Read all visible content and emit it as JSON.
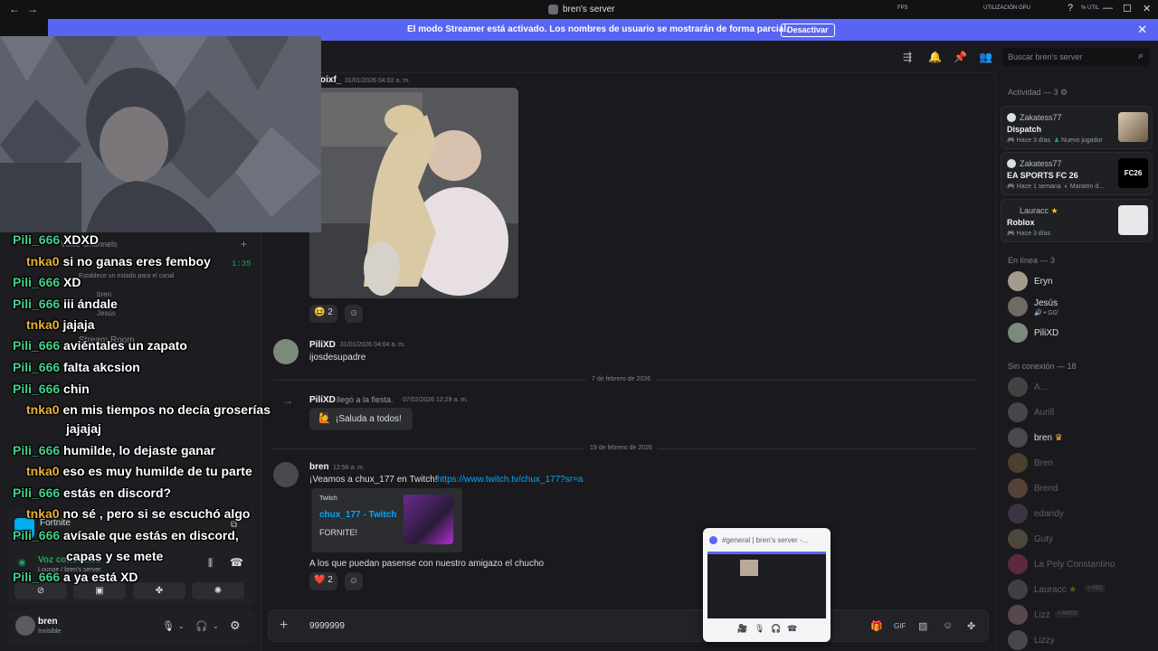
{
  "titlebar": {
    "back": "←",
    "forward": "→",
    "title": "bren's server",
    "fps": "FPS",
    "gpu": "UTILIZACIÓN GPU",
    "util": "% UTIL",
    "help": "?",
    "minimize": "—",
    "maximize": "☐",
    "close": "✕"
  },
  "banner": {
    "message": "El modo Streamer está activado. Los nombres de usuario se mostrarán de forma parcial.",
    "button": "Desactivar",
    "close": "✕"
  },
  "search": {
    "placeholder": "Buscar bren's server"
  },
  "sidebar": {
    "voice_channels": "Voice Channels",
    "timer": "1:35",
    "status_hint": "Establece un estado para el canal",
    "voice_users": [
      "bren",
      "Jesús"
    ],
    "stream_room": "Stream Room",
    "game": "Fortnite",
    "voice_connected": "Voz conectada",
    "voice_location": "Lounge / bren's server",
    "user_name": "bren",
    "user_status": "Invisible"
  },
  "messages": [
    {
      "author": "oixf_",
      "time": "31/01/2026 04:02 a. m.",
      "reactions": [
        {
          "emoji": "😆",
          "count": "2"
        }
      ]
    },
    {
      "author": "PiliXD",
      "time": "31/01/2026 04:04 a. m.",
      "text": "ijosdesupadre"
    },
    {
      "divider": "7 de febrero de 2026"
    },
    {
      "author": "PiliXD",
      "join_text": "llegó a la fiesta.",
      "time": "07/02/2026 12:29 a. m.",
      "button": "¡Saluda a todos!"
    },
    {
      "divider": "19 de febrero de 2026"
    },
    {
      "author": "bren",
      "time": "12:56 a. m.",
      "text": "¡Veamos a chux_177 en Twitch!",
      "link": "https://www.twitch.tv/chux_177?sr=a",
      "embed": {
        "provider": "Twitch",
        "title": "chux_177 - Twitch",
        "desc": "FORNITE!"
      },
      "text2": "A los que puedan pasense con nuestro amigazo el chucho",
      "reactions": [
        {
          "emoji": "❤️",
          "count": "2"
        }
      ]
    }
  ],
  "composer": {
    "value": "9999999"
  },
  "members": {
    "activity_header": "Actividad — 3",
    "activities": [
      {
        "user": "Zakatess77",
        "game": "Dispatch",
        "meta": "Hace 3 días",
        "meta2": "Nuevo jugador"
      },
      {
        "user": "Zakatess77",
        "game": "EA SPORTS FC 26",
        "meta": "Hace 1 semana",
        "meta2": "Maratón d...",
        "thumb": "FC26"
      },
      {
        "user": "Lauracc",
        "game": "Roblox",
        "meta": "Hace 3 días"
      }
    ],
    "online_header": "En línea — 3",
    "online": [
      {
        "name": "Eryn"
      },
      {
        "name": "Jesús",
        "sub": "• GG'"
      },
      {
        "name": "PiliXD"
      }
    ],
    "offline_header": "Sin conexión — 18",
    "offline": [
      "A...",
      "Aurill",
      "bren",
      "Bren",
      "Brend",
      "edandy",
      "Guty",
      "La Pely Constantino",
      "Lauracc",
      "Lizz",
      "Lizzy"
    ],
    "badges": {
      "lauracc": "FEC",
      "lizz": "HATO"
    }
  },
  "stream_chat": [
    {
      "user": "Pili_666",
      "color": "n1",
      "text": "XDXD"
    },
    {
      "user": "tnka0",
      "color": "n2",
      "text": "si no ganas eres femboy"
    },
    {
      "user": "Pili_666",
      "color": "n1",
      "text": "XD"
    },
    {
      "user": "Pili_666",
      "color": "n1",
      "text": "iii ándale"
    },
    {
      "user": "tnka0",
      "color": "n2",
      "text": "jajaja"
    },
    {
      "user": "Pili_666",
      "color": "n1",
      "text": "aviéntales un zapato"
    },
    {
      "user": "Pili_666",
      "color": "n1",
      "text": "falta akcsion"
    },
    {
      "user": "Pili_666",
      "color": "n1",
      "text": "chin"
    },
    {
      "user": "tnka0",
      "color": "n2",
      "text": "en mis tiempos no decía groserías"
    },
    {
      "user": "",
      "color": "n2",
      "text": "jajajaj"
    },
    {
      "user": "Pili_666",
      "color": "n1",
      "text": "humilde, lo dejaste ganar"
    },
    {
      "user": "tnka0",
      "color": "n2",
      "text": "eso es muy humilde de tu parte"
    },
    {
      "user": "Pili_666",
      "color": "n1",
      "text": "estás en discord?"
    },
    {
      "user": "tnka0",
      "color": "n2",
      "text": "no sé , pero si se escuchó algo"
    },
    {
      "user": "Pili_666",
      "color": "n1",
      "text": "avísale que estás en discord,"
    },
    {
      "user": "",
      "color": "n1",
      "text": "capas y se mete"
    },
    {
      "user": "Pili_666",
      "color": "n1",
      "text": "a ya está XD"
    }
  ],
  "pip": {
    "title": "#general | bren's server -..."
  },
  "colors": {
    "accent": "#5865f2",
    "online": "#23a55a",
    "link": "#00a8fc"
  }
}
